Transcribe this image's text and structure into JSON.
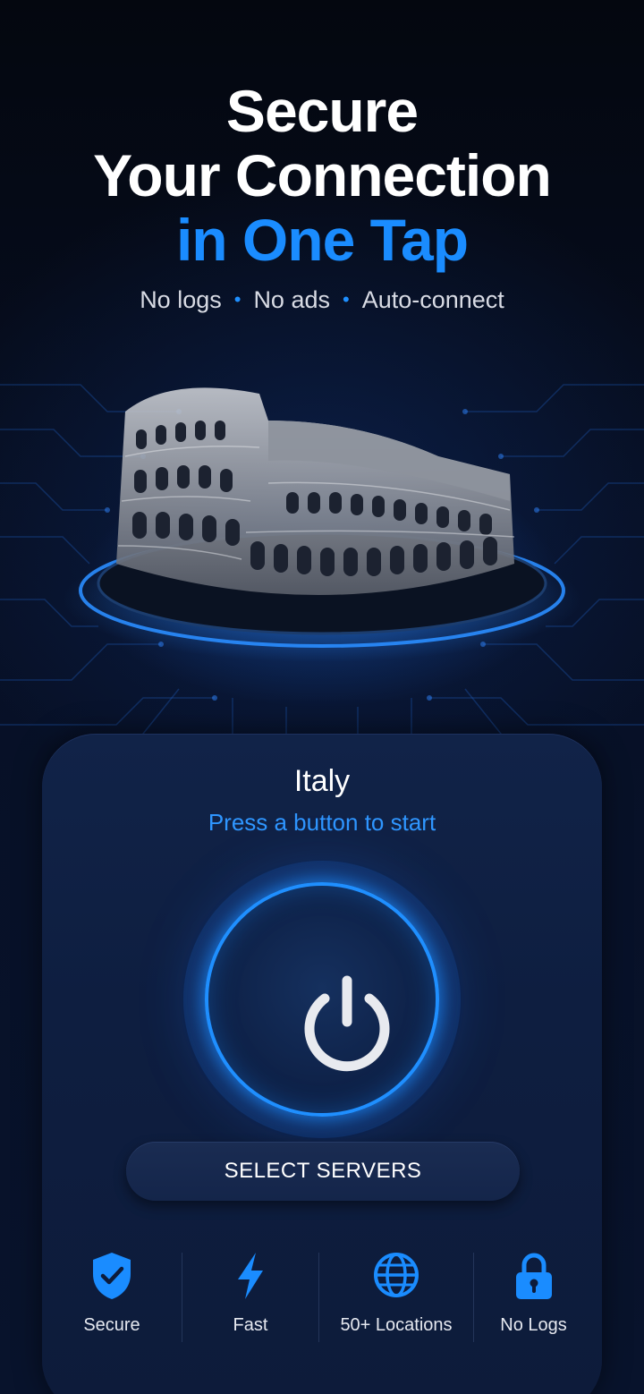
{
  "hero": {
    "title_line1": "Secure",
    "title_line2": "Your Connection",
    "title_line3": "in One Tap"
  },
  "subtitle": {
    "items": [
      "No logs",
      "No ads",
      "Auto-connect"
    ],
    "separator": "•"
  },
  "card": {
    "location": "Italy",
    "hint": "Press a button to start",
    "select_servers_label": "SELECT SERVERS"
  },
  "features": [
    {
      "label": "Secure",
      "icon": "shield-check-icon"
    },
    {
      "label": "Fast",
      "icon": "lightning-bolt-icon"
    },
    {
      "label": "50+ Locations",
      "icon": "globe-icon"
    },
    {
      "label": "No Logs",
      "icon": "padlock-icon"
    }
  ],
  "colors": {
    "accent": "#1a8cff",
    "background": "#060c1c",
    "card": "#0e1e40"
  }
}
